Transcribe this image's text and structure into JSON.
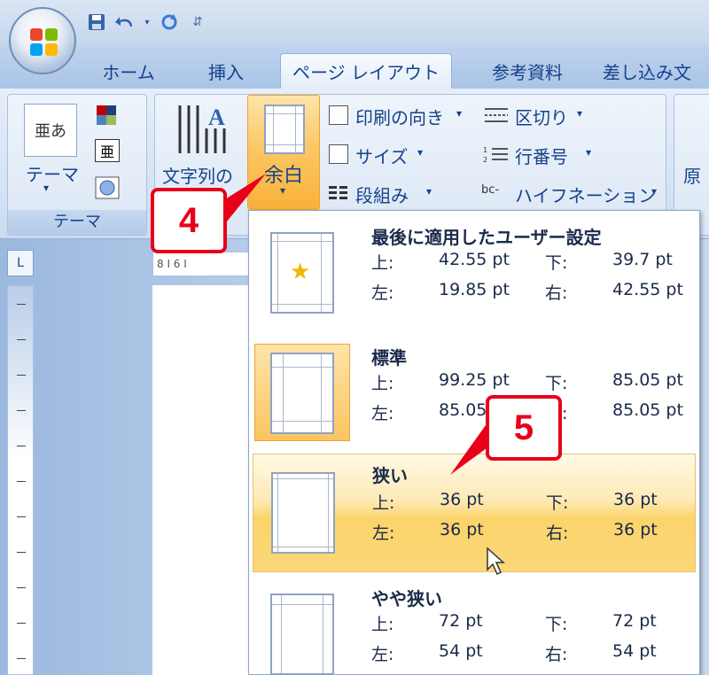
{
  "quick_access": {
    "save_icon": "save-icon",
    "undo_icon": "undo-icon",
    "redo_icon": "redo-icon",
    "customize_icon": "dropdown-icon"
  },
  "tabs": [
    {
      "label": "ホーム"
    },
    {
      "label": "挿入"
    },
    {
      "label": "ページ レイアウト"
    },
    {
      "label": "参考資料"
    },
    {
      "label": "差し込み文"
    }
  ],
  "ribbon": {
    "themes": {
      "button_label": "テーマ",
      "group_label": "テーマ",
      "theme_icon_text": "亜あ"
    },
    "text_direction": {
      "label": "文字列の"
    },
    "margins": {
      "label": "余白"
    },
    "page_setup": {
      "orientation": "印刷の向き",
      "size": "サイズ",
      "columns": "段組み",
      "breaks": "区切り",
      "line_numbers": "行番号",
      "hyphenation": "ハイフネーション"
    },
    "next_group_partial": "原"
  },
  "ruler": {
    "corner_glyph": "L",
    "h_ticks": "8 I 6 I"
  },
  "margins_menu": {
    "options": [
      {
        "title": "最後に適用したユーザー設定",
        "top_label": "上:",
        "top": "42.55 pt",
        "bottom_label": "下:",
        "bottom": "39.7 pt",
        "left_label": "左:",
        "left": "19.85 pt",
        "right_label": "右:",
        "right": "42.55 pt"
      },
      {
        "title": "標準",
        "top_label": "上:",
        "top": "99.25 pt",
        "bottom_label": "下:",
        "bottom": "85.05 pt",
        "left_label": "左:",
        "left": "85.05",
        "right_label": "右:",
        "right": "85.05 pt"
      },
      {
        "title": "狭い",
        "top_label": "上:",
        "top": "36 pt",
        "bottom_label": "下:",
        "bottom": "36 pt",
        "left_label": "左:",
        "left": "36 pt",
        "right_label": "右:",
        "right": "36 pt"
      },
      {
        "title": "やや狭い",
        "top_label": "上:",
        "top": "72 pt",
        "bottom_label": "下:",
        "bottom": "72 pt",
        "left_label": "左:",
        "left": "54 pt",
        "right_label": "右:",
        "right": "54 pt"
      }
    ]
  },
  "callouts": {
    "step4": "4",
    "step5": "5"
  },
  "colors": {
    "callout_red": "#e8001a",
    "hover_orange": "#fbd46a",
    "ribbon_blue": "#15428b"
  }
}
